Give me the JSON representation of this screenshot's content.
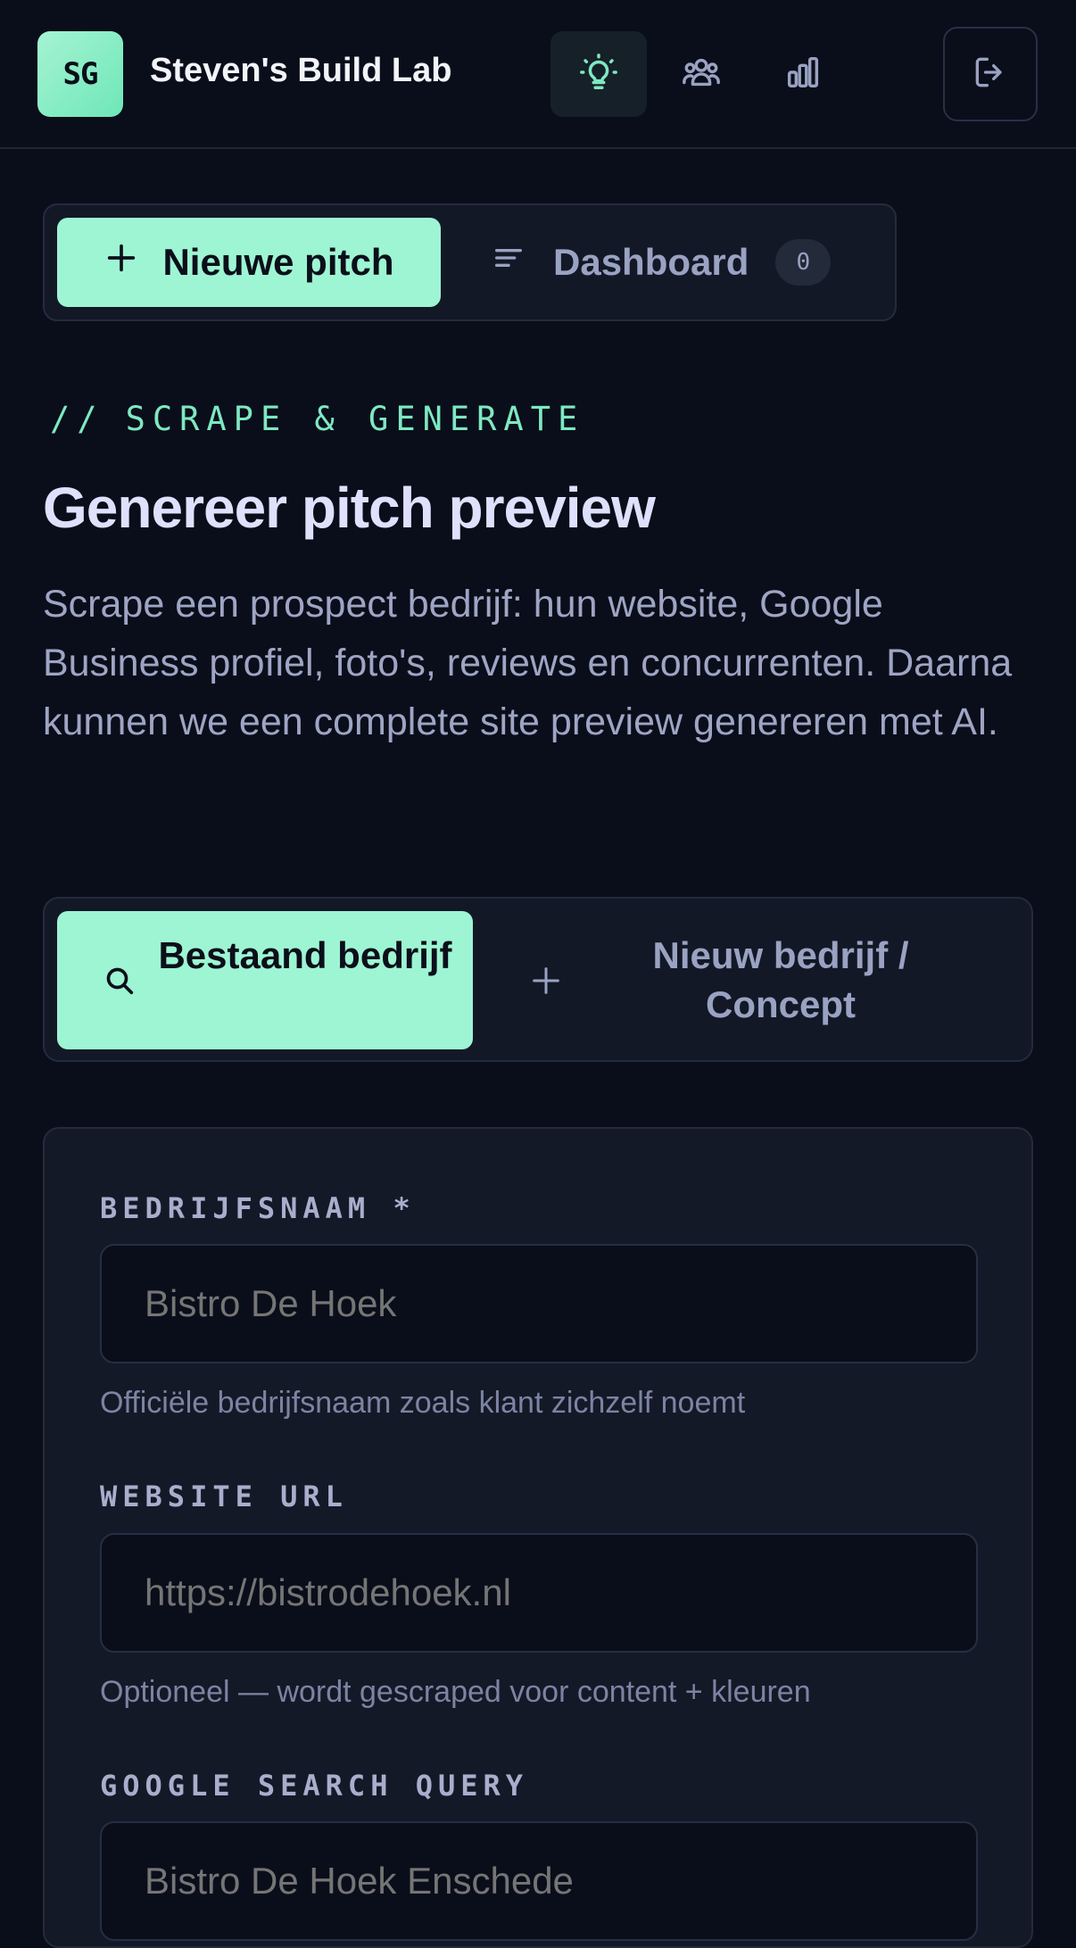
{
  "header": {
    "logo_initials": "SG",
    "brand": "Steven's Build Lab",
    "nav": [
      {
        "icon": "lightbulb-icon",
        "active": true
      },
      {
        "icon": "users-icon",
        "active": false
      },
      {
        "icon": "bar-chart-icon",
        "active": false
      }
    ],
    "logout_icon": "logout-icon"
  },
  "topbar": {
    "new_pitch_label": "Nieuwe pitch",
    "dashboard_label": "Dashboard",
    "dashboard_count": "0"
  },
  "hero": {
    "eyebrow_prefix": "//",
    "eyebrow": "SCRAPE & GENERATE",
    "title": "Genereer pitch preview",
    "description": "Scrape een prospect bedrijf: hun website, Google Business profiel, foto's, reviews en concurrenten. Daarna kunnen we een complete site preview genereren met AI."
  },
  "mode": {
    "existing_label": "Bestaand bedrijf",
    "new_label": "Nieuw bedrijf / Concept",
    "selected": "existing"
  },
  "form": {
    "company_name": {
      "label": "BEDRIJFSNAAM *",
      "placeholder": "Bistro De Hoek",
      "value": "",
      "help": "Officiële bedrijfsnaam zoals klant zichzelf noemt"
    },
    "website_url": {
      "label": "WEBSITE URL",
      "placeholder": "https://bistrodehoek.nl",
      "value": "",
      "help": "Optioneel — wordt gescraped voor content + kleuren"
    },
    "google_query": {
      "label": "GOOGLE SEARCH QUERY",
      "placeholder": "Bistro De Hoek Enschede",
      "value": ""
    }
  },
  "colors": {
    "accent": "#9ef5d3",
    "background": "#0a0e1a",
    "card": "#141927",
    "muted_text": "#9ea5c4"
  }
}
